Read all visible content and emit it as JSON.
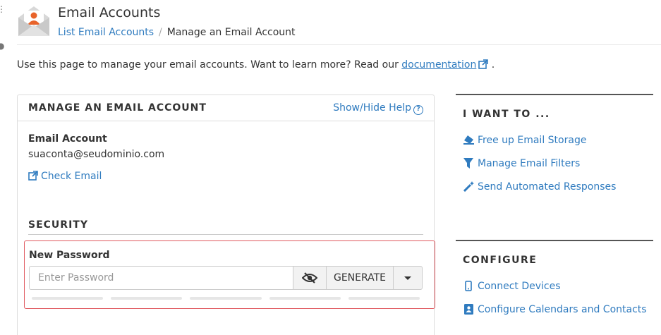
{
  "header": {
    "title": "Email Accounts",
    "breadcrumb": [
      {
        "label": "List Email Accounts"
      },
      {
        "label": "Manage an Email Account"
      }
    ]
  },
  "intro": {
    "text": "Use this page to manage your email accounts. Want to learn more? Read our ",
    "link": "documentation",
    "suffix": "."
  },
  "panel": {
    "title": "MANAGE AN EMAIL ACCOUNT",
    "help_link": "Show/Hide Help",
    "email_account_label": "Email Account",
    "email_account_value": "suaconta@seudominio.com",
    "check_email": "Check Email",
    "security_title": "SECURITY",
    "password": {
      "label": "New Password",
      "placeholder": "Enter Password",
      "generate": "GENERATE",
      "strength_level": 0
    }
  },
  "i_want_to": {
    "title": "I WANT TO ...",
    "items": [
      {
        "label": "Free up Email Storage",
        "icon": "eraser-icon"
      },
      {
        "label": "Manage Email Filters",
        "icon": "filter-icon"
      },
      {
        "label": "Send Automated Responses",
        "icon": "magic-wand-icon"
      }
    ]
  },
  "configure": {
    "title": "CONFIGURE",
    "items": [
      {
        "label": "Connect Devices",
        "icon": "mobile-icon"
      },
      {
        "label": "Configure Calendars and Contacts",
        "icon": "address-book-icon"
      }
    ]
  },
  "colors": {
    "link": "#2f7bbf",
    "highlight_border": "#e0585e",
    "app_icon_accent": "#e8632a"
  }
}
